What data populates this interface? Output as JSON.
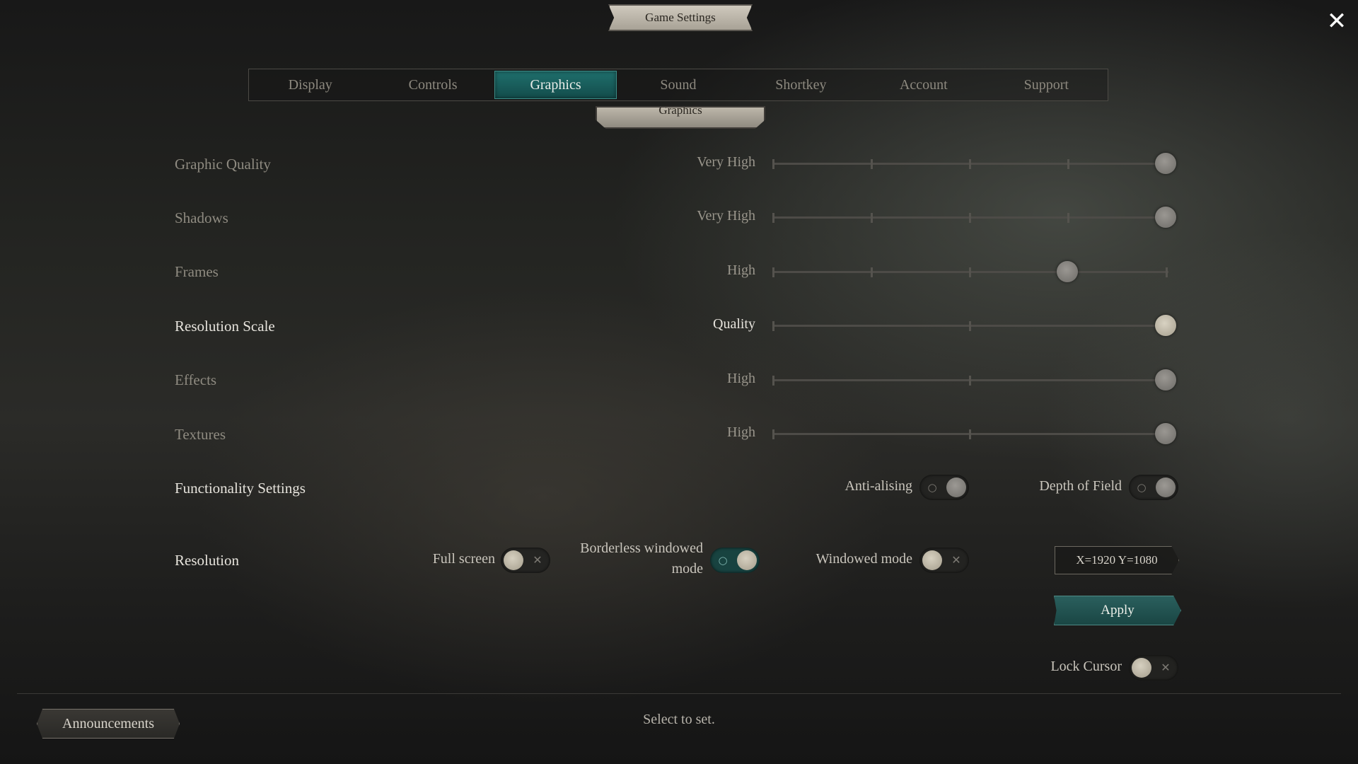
{
  "window": {
    "title": "Game Settings"
  },
  "tabs": [
    {
      "label": "Display",
      "active": false
    },
    {
      "label": "Controls",
      "active": false
    },
    {
      "label": "Graphics",
      "active": true
    },
    {
      "label": "Sound",
      "active": false
    },
    {
      "label": "Shortkey",
      "active": false
    },
    {
      "label": "Account",
      "active": false
    },
    {
      "label": "Support",
      "active": false
    }
  ],
  "section_title": "Graphics",
  "settings": [
    {
      "label": "Graphic Quality",
      "value": "Very High",
      "level": 4,
      "max": 4
    },
    {
      "label": "Shadows",
      "value": "Very High",
      "level": 4,
      "max": 4
    },
    {
      "label": "Frames",
      "value": "High",
      "level": 3,
      "max": 4
    },
    {
      "label": "Resolution Scale",
      "value": "Quality",
      "level": 2,
      "max": 2
    },
    {
      "label": "Effects",
      "value": "High",
      "level": 2,
      "max": 2
    },
    {
      "label": "Textures",
      "value": "High",
      "level": 2,
      "max": 2
    }
  ],
  "functionality": {
    "label": "Functionality Settings",
    "anti_aliasing": {
      "label": "Anti-alising",
      "on": true
    },
    "depth_of_field": {
      "label": "Depth of Field",
      "on": true
    }
  },
  "resolution": {
    "label": "Resolution",
    "full_screen": {
      "label": "Full screen",
      "on": false
    },
    "borderless_line1": "Borderless windowed",
    "borderless_line2": "mode",
    "borderless_on": true,
    "windowed": {
      "label": "Windowed mode",
      "on": false
    },
    "size_value": "X=1920 Y=1080",
    "apply_label": "Apply"
  },
  "lock_cursor": {
    "label": "Lock Cursor",
    "on": false
  },
  "footer": {
    "announcements_label": "Announcements",
    "hint": "Select to set."
  },
  "icons": {
    "close": "close-icon",
    "toggle_off": "x-icon",
    "toggle_on": "circle-icon"
  },
  "colors": {
    "accent_teal": "#1f6f6c",
    "text_bright": "#e6e3dc",
    "text_dim": "#8f8b81"
  }
}
